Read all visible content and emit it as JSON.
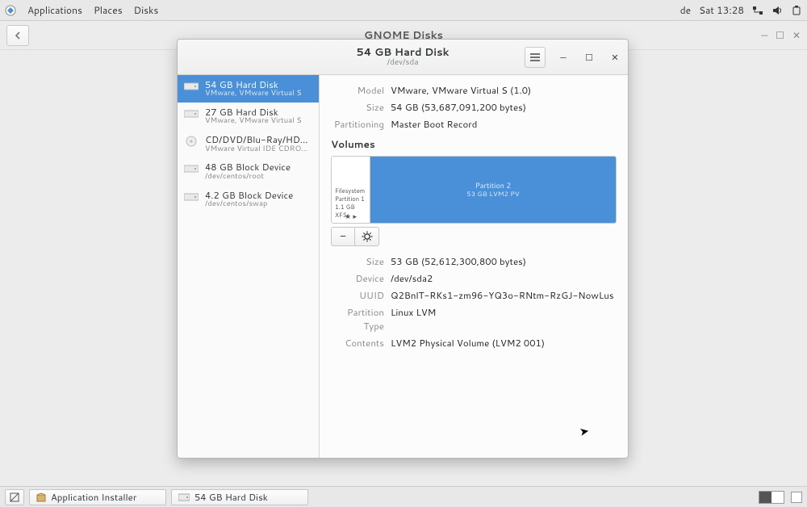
{
  "top_panel": {
    "menus": [
      "Applications",
      "Places",
      "Disks"
    ],
    "lang": "de",
    "clock": "Sat 13:28"
  },
  "toolbar": {
    "title": "GNOME Disks"
  },
  "disks": {
    "header": {
      "title": "54 GB Hard Disk",
      "subtitle": "/dev/sda"
    },
    "devices": [
      {
        "title": "54 GB Hard Disk",
        "sub": "VMware, VMware Virtual S",
        "icon": "hdd",
        "selected": true
      },
      {
        "title": "27 GB Hard Disk",
        "sub": "VMware, VMware Virtual S",
        "icon": "hdd",
        "selected": false
      },
      {
        "title": "CD/DVD/Blu-Ray/HDDVD Drive",
        "sub": "VMware Virtual IDE CDROM Drive",
        "icon": "disc",
        "selected": false
      },
      {
        "title": "48 GB Block Device",
        "sub": "/dev/centos/root",
        "icon": "hdd",
        "selected": false
      },
      {
        "title": "4.2 GB Block Device",
        "sub": "/dev/centos/swap",
        "icon": "hdd",
        "selected": false
      }
    ],
    "disk_info": {
      "Model": "VMware, VMware Virtual S (1.0)",
      "Size": "54 GB (53,687,091,200 bytes)",
      "Partitioning": "Master Boot Record"
    },
    "volumes_label": "Volumes",
    "partitions": {
      "seg1": {
        "l1": "Filesystem",
        "l2": "Partition 1",
        "l3": "1.1 GB XFS"
      },
      "seg2": {
        "title": "Partition 2",
        "sub": "53 GB LVM2 PV"
      }
    },
    "selected_partition": {
      "Size": "53 GB (52,612,300,800 bytes)",
      "Device": "/dev/sda2",
      "UUID": "Q2BnlT-RKs1-zm96-YQ3o-RNtm-RzGJ-NowLus",
      "Partition Type": "Linux LVM",
      "Contents": "LVM2 Physical Volume (LVM2 001)"
    }
  },
  "taskbar": {
    "items": [
      "Application Installer",
      "54 GB Hard Disk"
    ]
  }
}
